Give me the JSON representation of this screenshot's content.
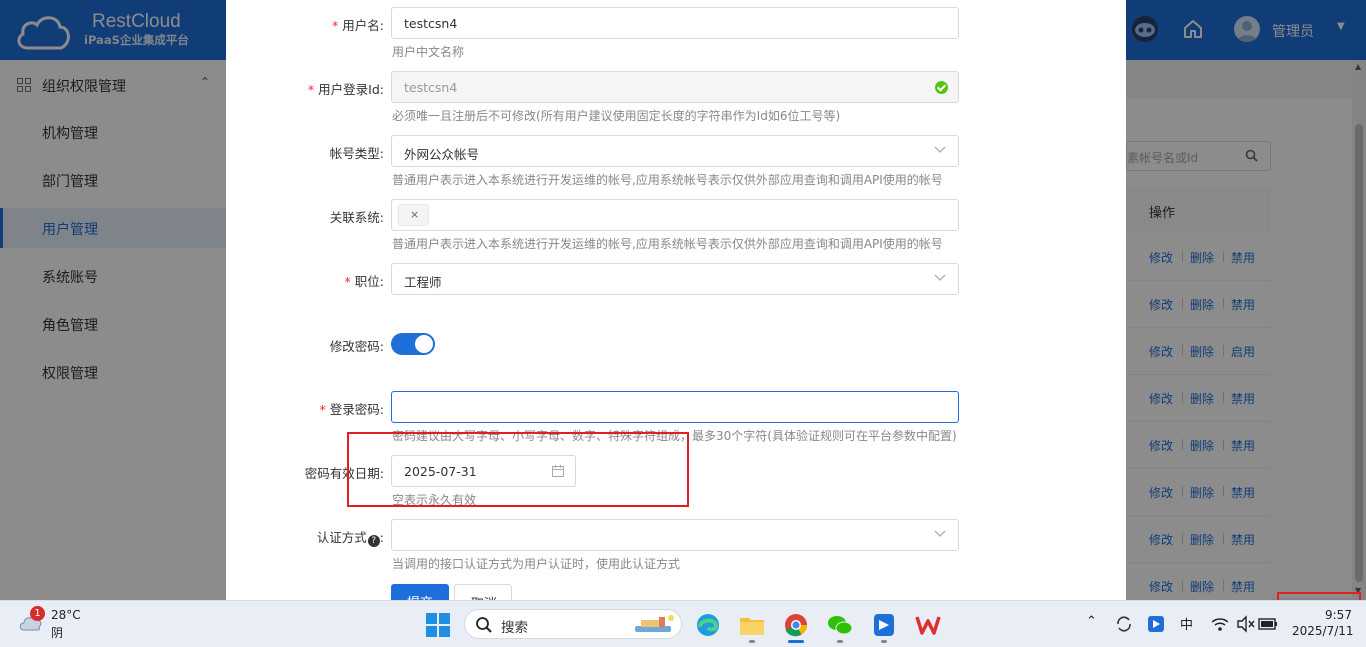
{
  "header": {
    "brand": "RestCloud",
    "brand_sub": "iPaaS企业集成平台",
    "user_name": "管理员",
    "caret": "▼"
  },
  "sidebar": {
    "group_label": "组织权限管理",
    "group_caret": "⌃",
    "items": [
      {
        "label": "机构管理"
      },
      {
        "label": "部门管理"
      },
      {
        "label": "用户管理",
        "active": true
      },
      {
        "label": "系统账号"
      },
      {
        "label": "角色管理"
      },
      {
        "label": "权限管理"
      }
    ]
  },
  "background_table": {
    "search_placeholder": "素帐号名或Id",
    "ops_header": "操作",
    "rows": [
      {
        "edit": "修改",
        "delete": "删除",
        "toggle": "禁用"
      },
      {
        "edit": "修改",
        "delete": "删除",
        "toggle": "禁用"
      },
      {
        "edit": "修改",
        "delete": "删除",
        "toggle": "启用"
      },
      {
        "edit": "修改",
        "delete": "删除",
        "toggle": "禁用"
      },
      {
        "edit": "修改",
        "delete": "删除",
        "toggle": "禁用"
      },
      {
        "edit": "修改",
        "delete": "删除",
        "toggle": "禁用"
      },
      {
        "edit": "修改",
        "delete": "删除",
        "toggle": "禁用"
      },
      {
        "edit": "修改",
        "delete": "删除",
        "toggle": "禁用"
      }
    ]
  },
  "form": {
    "required_mark": "*",
    "username": {
      "label": "用户名:",
      "value": "testcsn4",
      "hint": "用户中文名称"
    },
    "login_id": {
      "label": "用户登录Id:",
      "value": "testcsn4",
      "hint": "必须唯一且注册后不可修改(所有用户建议使用固定长度的字符串作为Id如6位工号等)"
    },
    "account_type": {
      "label": "帐号类型:",
      "value": "外网公众帐号",
      "hint": "普通用户表示进入本系统进行开发运维的帐号,应用系统帐号表示仅供外部应用查询和调用API使用的帐号"
    },
    "linked_system": {
      "label": "关联系统:",
      "tag_close": "×",
      "hint": "普通用户表示进入本系统进行开发运维的帐号,应用系统帐号表示仅供外部应用查询和调用API使用的帐号"
    },
    "position": {
      "label": "职位:",
      "value": "工程师"
    },
    "change_password": {
      "label": "修改密码:",
      "enabled": true
    },
    "login_password": {
      "label": "登录密码:",
      "value": "",
      "hint": "密码建议由大写字母、小写字母、数字、特殊字符组成，最多30个字符(具体验证规则可在平台参数中配置)"
    },
    "password_expiry": {
      "label": "密码有效日期:",
      "value": "2025-07-31",
      "hint": "空表示永久有效"
    },
    "auth_method": {
      "label": "认证方式",
      "label_suffix": ":",
      "help_mark": "?",
      "value": "",
      "hint": "当调用的接口认证方式为用户认证时，使用此认证方式"
    },
    "submit_label": "提交",
    "cancel_label": "取消"
  },
  "taskbar": {
    "weather_badge": "1",
    "temperature": "28°C",
    "weather": "阴",
    "search_label": "搜索",
    "ime": "中",
    "time": "9:57",
    "date": "2025/7/11",
    "apps": [
      "edge-icon",
      "file-explorer-icon",
      "chrome-icon",
      "wechat-icon",
      "feishu-icon",
      "wps-icon"
    ]
  },
  "colors": {
    "brand": "#1e6fd9",
    "annotation": "#e02020",
    "required": "#f5222d",
    "success": "#52c41a"
  }
}
